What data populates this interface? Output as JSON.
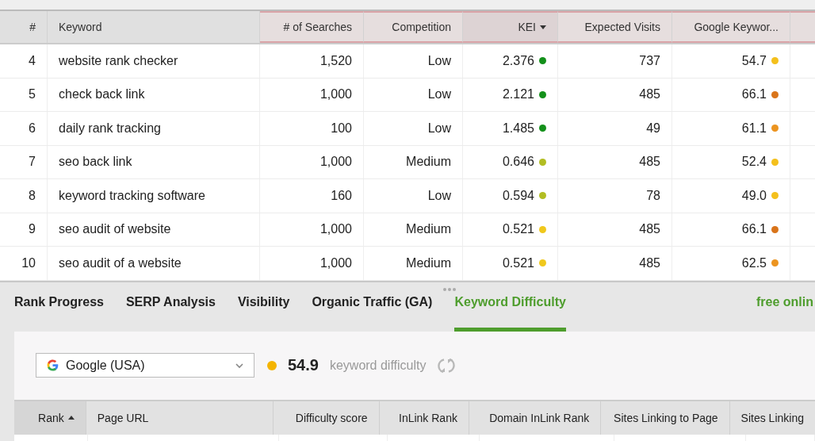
{
  "keywords_table": {
    "sort_descending": true,
    "columns": [
      {
        "label": "#",
        "highlighted": false,
        "sorted": false
      },
      {
        "label": "Keyword",
        "highlighted": false,
        "sorted": false
      },
      {
        "label": "# of Searches",
        "highlighted": true,
        "sorted": false
      },
      {
        "label": "Competition",
        "highlighted": true,
        "sorted": false
      },
      {
        "label": "KEI",
        "highlighted": true,
        "sorted": true
      },
      {
        "label": "Expected Visits",
        "highlighted": true,
        "sorted": false
      },
      {
        "label": "Google Keywor...",
        "highlighted": true,
        "sorted": false
      }
    ],
    "rows": [
      {
        "num": "4",
        "keyword": "website rank checker",
        "searches": "1,520",
        "competition": "Low",
        "kei": {
          "value": "2.376",
          "color": "#13901a"
        },
        "visits": "737",
        "difficulty": {
          "value": "54.7",
          "color": "#f4c01c"
        }
      },
      {
        "num": "5",
        "keyword": "check back link",
        "searches": "1,000",
        "competition": "Low",
        "kei": {
          "value": "2.121",
          "color": "#13901a"
        },
        "visits": "485",
        "difficulty": {
          "value": "66.1",
          "color": "#d9741a"
        }
      },
      {
        "num": "6",
        "keyword": "daily rank tracking",
        "searches": "100",
        "competition": "Low",
        "kei": {
          "value": "1.485",
          "color": "#13901a"
        },
        "visits": "49",
        "difficulty": {
          "value": "61.1",
          "color": "#ec9420"
        }
      },
      {
        "num": "7",
        "keyword": "seo back link",
        "searches": "1,000",
        "competition": "Medium",
        "kei": {
          "value": "0.646",
          "color": "#b2bd22"
        },
        "visits": "485",
        "difficulty": {
          "value": "52.4",
          "color": "#f4c01c"
        }
      },
      {
        "num": "8",
        "keyword": "keyword tracking software",
        "searches": "160",
        "competition": "Low",
        "kei": {
          "value": "0.594",
          "color": "#b2bd22"
        },
        "visits": "78",
        "difficulty": {
          "value": "49.0",
          "color": "#f4c01c"
        }
      },
      {
        "num": "9",
        "keyword": "seo audit of website",
        "searches": "1,000",
        "competition": "Medium",
        "kei": {
          "value": "0.521",
          "color": "#f0c81c"
        },
        "visits": "485",
        "difficulty": {
          "value": "66.1",
          "color": "#d9741a"
        }
      },
      {
        "num": "10",
        "keyword": "seo audit of a website",
        "searches": "1,000",
        "competition": "Medium",
        "kei": {
          "value": "0.521",
          "color": "#f0c81c"
        },
        "visits": "485",
        "difficulty": {
          "value": "62.5",
          "color": "#ec9420"
        }
      }
    ]
  },
  "tabs": [
    {
      "label": "Rank Progress",
      "selected": false
    },
    {
      "label": "SERP Analysis",
      "selected": false
    },
    {
      "label": "Visibility",
      "selected": false
    },
    {
      "label": "Organic Traffic (GA)",
      "selected": false
    },
    {
      "label": "Keyword Difficulty",
      "selected": true
    }
  ],
  "tabs_right_text": "free onlin",
  "difficulty_panel": {
    "search_engine": "Google (USA)",
    "score": {
      "value": "54.9",
      "color": "#f4b400"
    },
    "score_label": "keyword difficulty",
    "table": {
      "sort_descending": false,
      "columns": [
        {
          "label": "Rank",
          "sorted": true
        },
        {
          "label": "Page URL",
          "sorted": false
        },
        {
          "label": "Difficulty score",
          "sorted": false
        },
        {
          "label": "InLink Rank",
          "sorted": false
        },
        {
          "label": "Domain InLink Rank",
          "sorted": false
        },
        {
          "label": "Sites Linking to Page",
          "sorted": false
        },
        {
          "label": "Sites Linking",
          "sorted": false
        }
      ]
    }
  }
}
